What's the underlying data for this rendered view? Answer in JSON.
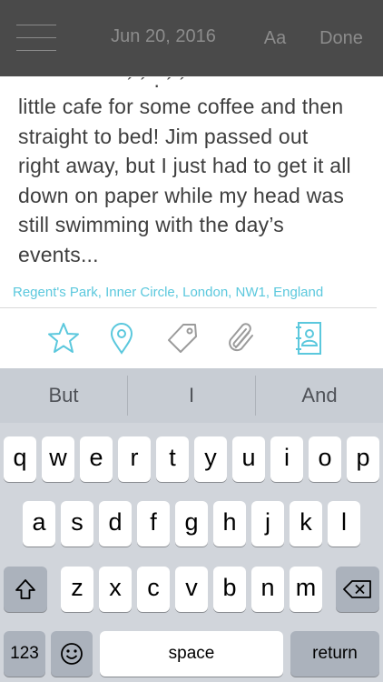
{
  "header": {
    "date": "Jun 20, 2016",
    "font_button": "Aa",
    "done_button": "Done"
  },
  "entry": {
    "top_fragment": "´ ´ · ´ ´",
    "lines": [
      "little cafe for some coffee and then",
      "straight to bed! Jim passed out",
      "right away, but I just had to get it all",
      "down on paper while my head was",
      "still swimming with the day’s",
      "events..."
    ],
    "location": "Regent's Park, Inner Circle, London, NW1, England"
  },
  "toolbar": {
    "icons": [
      "star-icon",
      "location-pin-icon",
      "tag-icon",
      "paperclip-icon",
      "contact-book-icon"
    ],
    "accent_color": "#5bc8dd",
    "inactive_color": "#9b9b9b"
  },
  "keyboard": {
    "predictions": [
      "But",
      "I",
      "And"
    ],
    "row1": [
      "q",
      "w",
      "e",
      "r",
      "t",
      "y",
      "u",
      "i",
      "o",
      "p"
    ],
    "row2": [
      "a",
      "s",
      "d",
      "f",
      "g",
      "h",
      "j",
      "k",
      "l"
    ],
    "row3": [
      "z",
      "x",
      "c",
      "v",
      "b",
      "n",
      "m"
    ],
    "numbers_key": "123",
    "space_key": "space",
    "return_key": "return"
  }
}
